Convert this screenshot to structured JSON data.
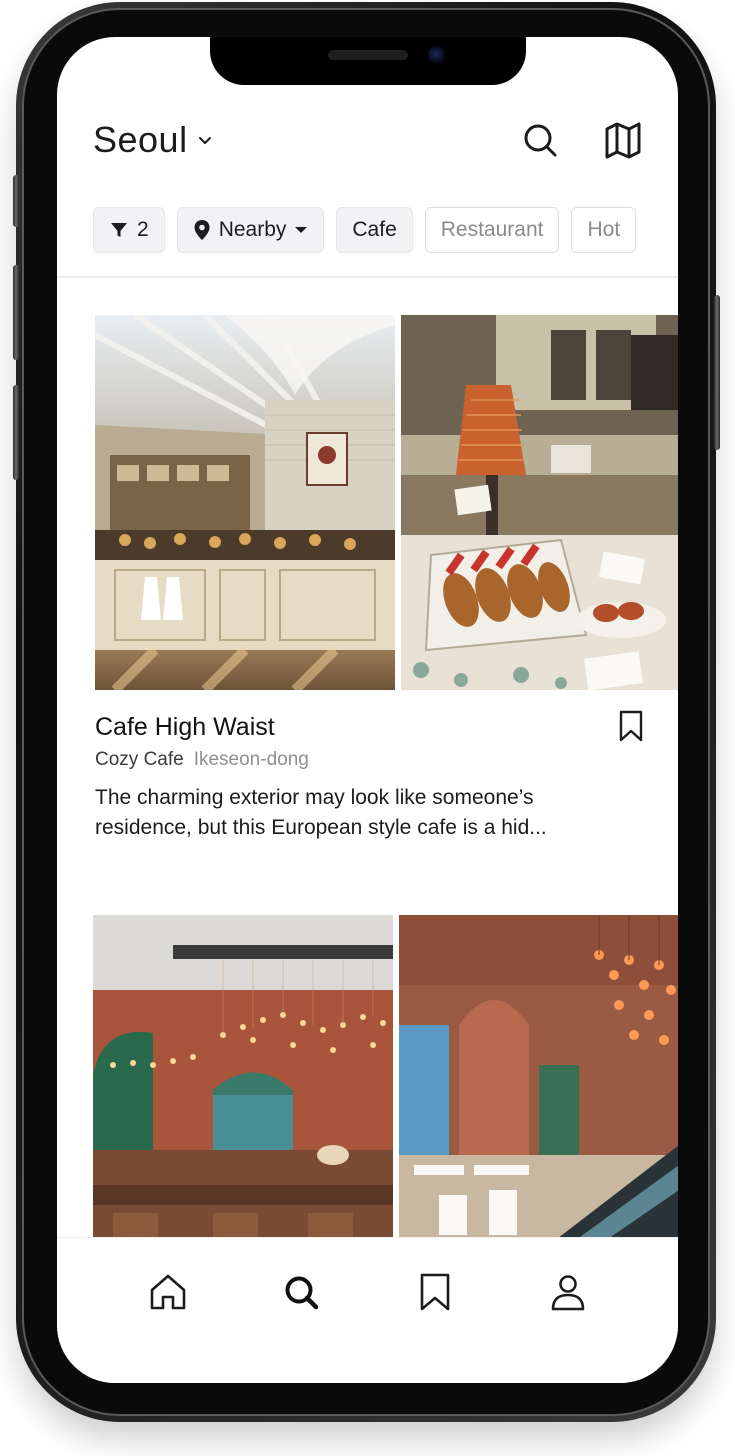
{
  "header": {
    "city": "Seoul",
    "city_dropdown_icon": "chevron-down-icon",
    "search_icon": "search-icon",
    "map_icon": "map-icon"
  },
  "filters": {
    "filter_count": "2",
    "filter_icon": "funnel-icon",
    "location_label": "Nearby",
    "location_icon": "location-pin-icon",
    "chips": [
      {
        "label": "Cafe",
        "selected": true
      },
      {
        "label": "Restaurant",
        "selected": false
      },
      {
        "label": "Hot",
        "selected": false
      }
    ]
  },
  "cards": [
    {
      "title": "Cafe High Waist",
      "category": "Cozy Cafe",
      "location": "Ikeseon-dong",
      "description": "The charming exterior may look like someone’s residence, but this European style cafe is a hid...",
      "bookmark_icon": "bookmark-icon"
    },
    {
      "title": "",
      "category": "",
      "location": "",
      "description": ""
    }
  ],
  "bottom_nav": [
    {
      "icon": "home-icon",
      "active": false
    },
    {
      "icon": "search-icon",
      "active": true
    },
    {
      "icon": "bookmark-icon",
      "active": false
    },
    {
      "icon": "profile-icon",
      "active": false
    }
  ],
  "colors": {
    "text_primary": "#1c1c1e",
    "text_secondary": "#8e8e93",
    "chip_bg": "#f2f2f4",
    "chip_border": "#dcdce0"
  }
}
